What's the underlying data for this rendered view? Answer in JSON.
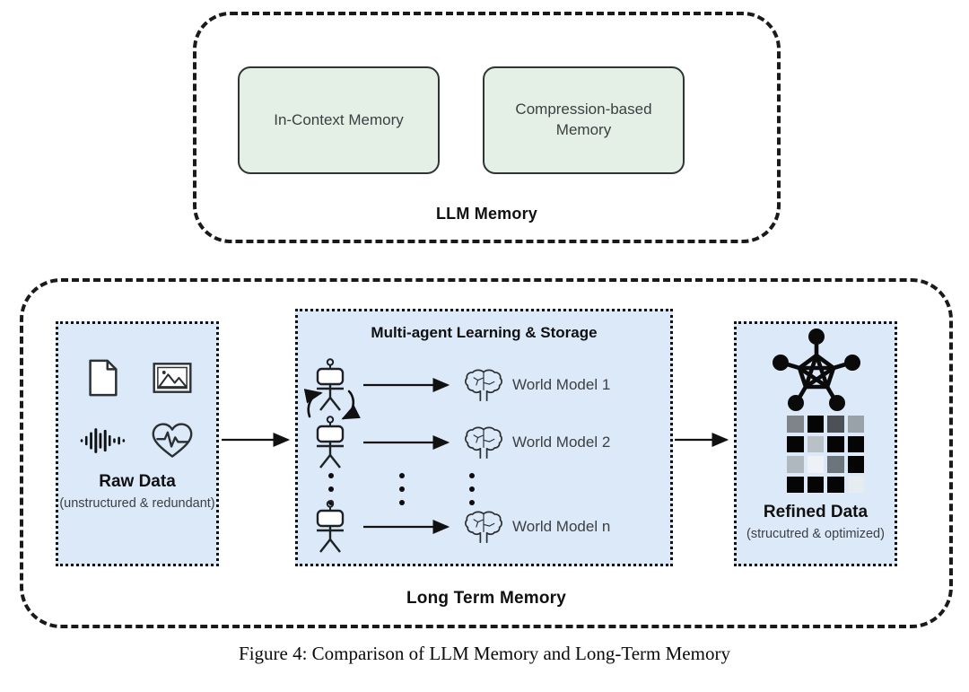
{
  "figure": {
    "caption": "Figure 4: Comparison of LLM Memory and Long-Term Memory"
  },
  "llm_memory": {
    "label": "LLM Memory",
    "boxes": [
      {
        "label": "In-Context Memory",
        "name": "in-context-memory"
      },
      {
        "label": "Compression-based Memory",
        "name": "compression-based-memory"
      }
    ]
  },
  "long_term_memory": {
    "label": "Long Term Memory",
    "raw_data": {
      "title": "Raw Data",
      "subtitle": "(unstructured & redundant)",
      "icons": [
        "document-icon",
        "image-icon",
        "audio-waveform-icon",
        "heartbeat-icon"
      ]
    },
    "agents": {
      "title": "Multi-agent Learning & Storage",
      "rows": [
        {
          "agent": "agent-robot-icon",
          "model": "World Model 1"
        },
        {
          "agent": "agent-robot-icon",
          "model": "World Model 2"
        },
        {
          "agent": "agent-robot-icon",
          "model": "World Model n"
        }
      ],
      "ellipsis": "⋮"
    },
    "refined_data": {
      "title": "Refined Data",
      "subtitle": "(strucutred & optimized)",
      "icons": [
        "knowledge-graph-icon",
        "matrix-grid-icon"
      ],
      "matrix": [
        [
          "#7e8489",
          "#050505",
          "#4b5156",
          "#9aa2a9"
        ],
        [
          "#050505",
          "#b9c0c6",
          "#050505",
          "#050505"
        ],
        [
          "#b0b8bf",
          "#eef2f6",
          "#6d757c",
          "#050505"
        ],
        [
          "#050505",
          "#050505",
          "#050505",
          "#e7ecf1"
        ]
      ]
    },
    "flow_arrows": [
      "raw-to-agents",
      "agents-to-refined"
    ]
  },
  "colors": {
    "panel_blue": "#dce9f9",
    "box_green": "#e4f0e6",
    "outline": "#1a1a1a",
    "text": "#3c4043"
  }
}
